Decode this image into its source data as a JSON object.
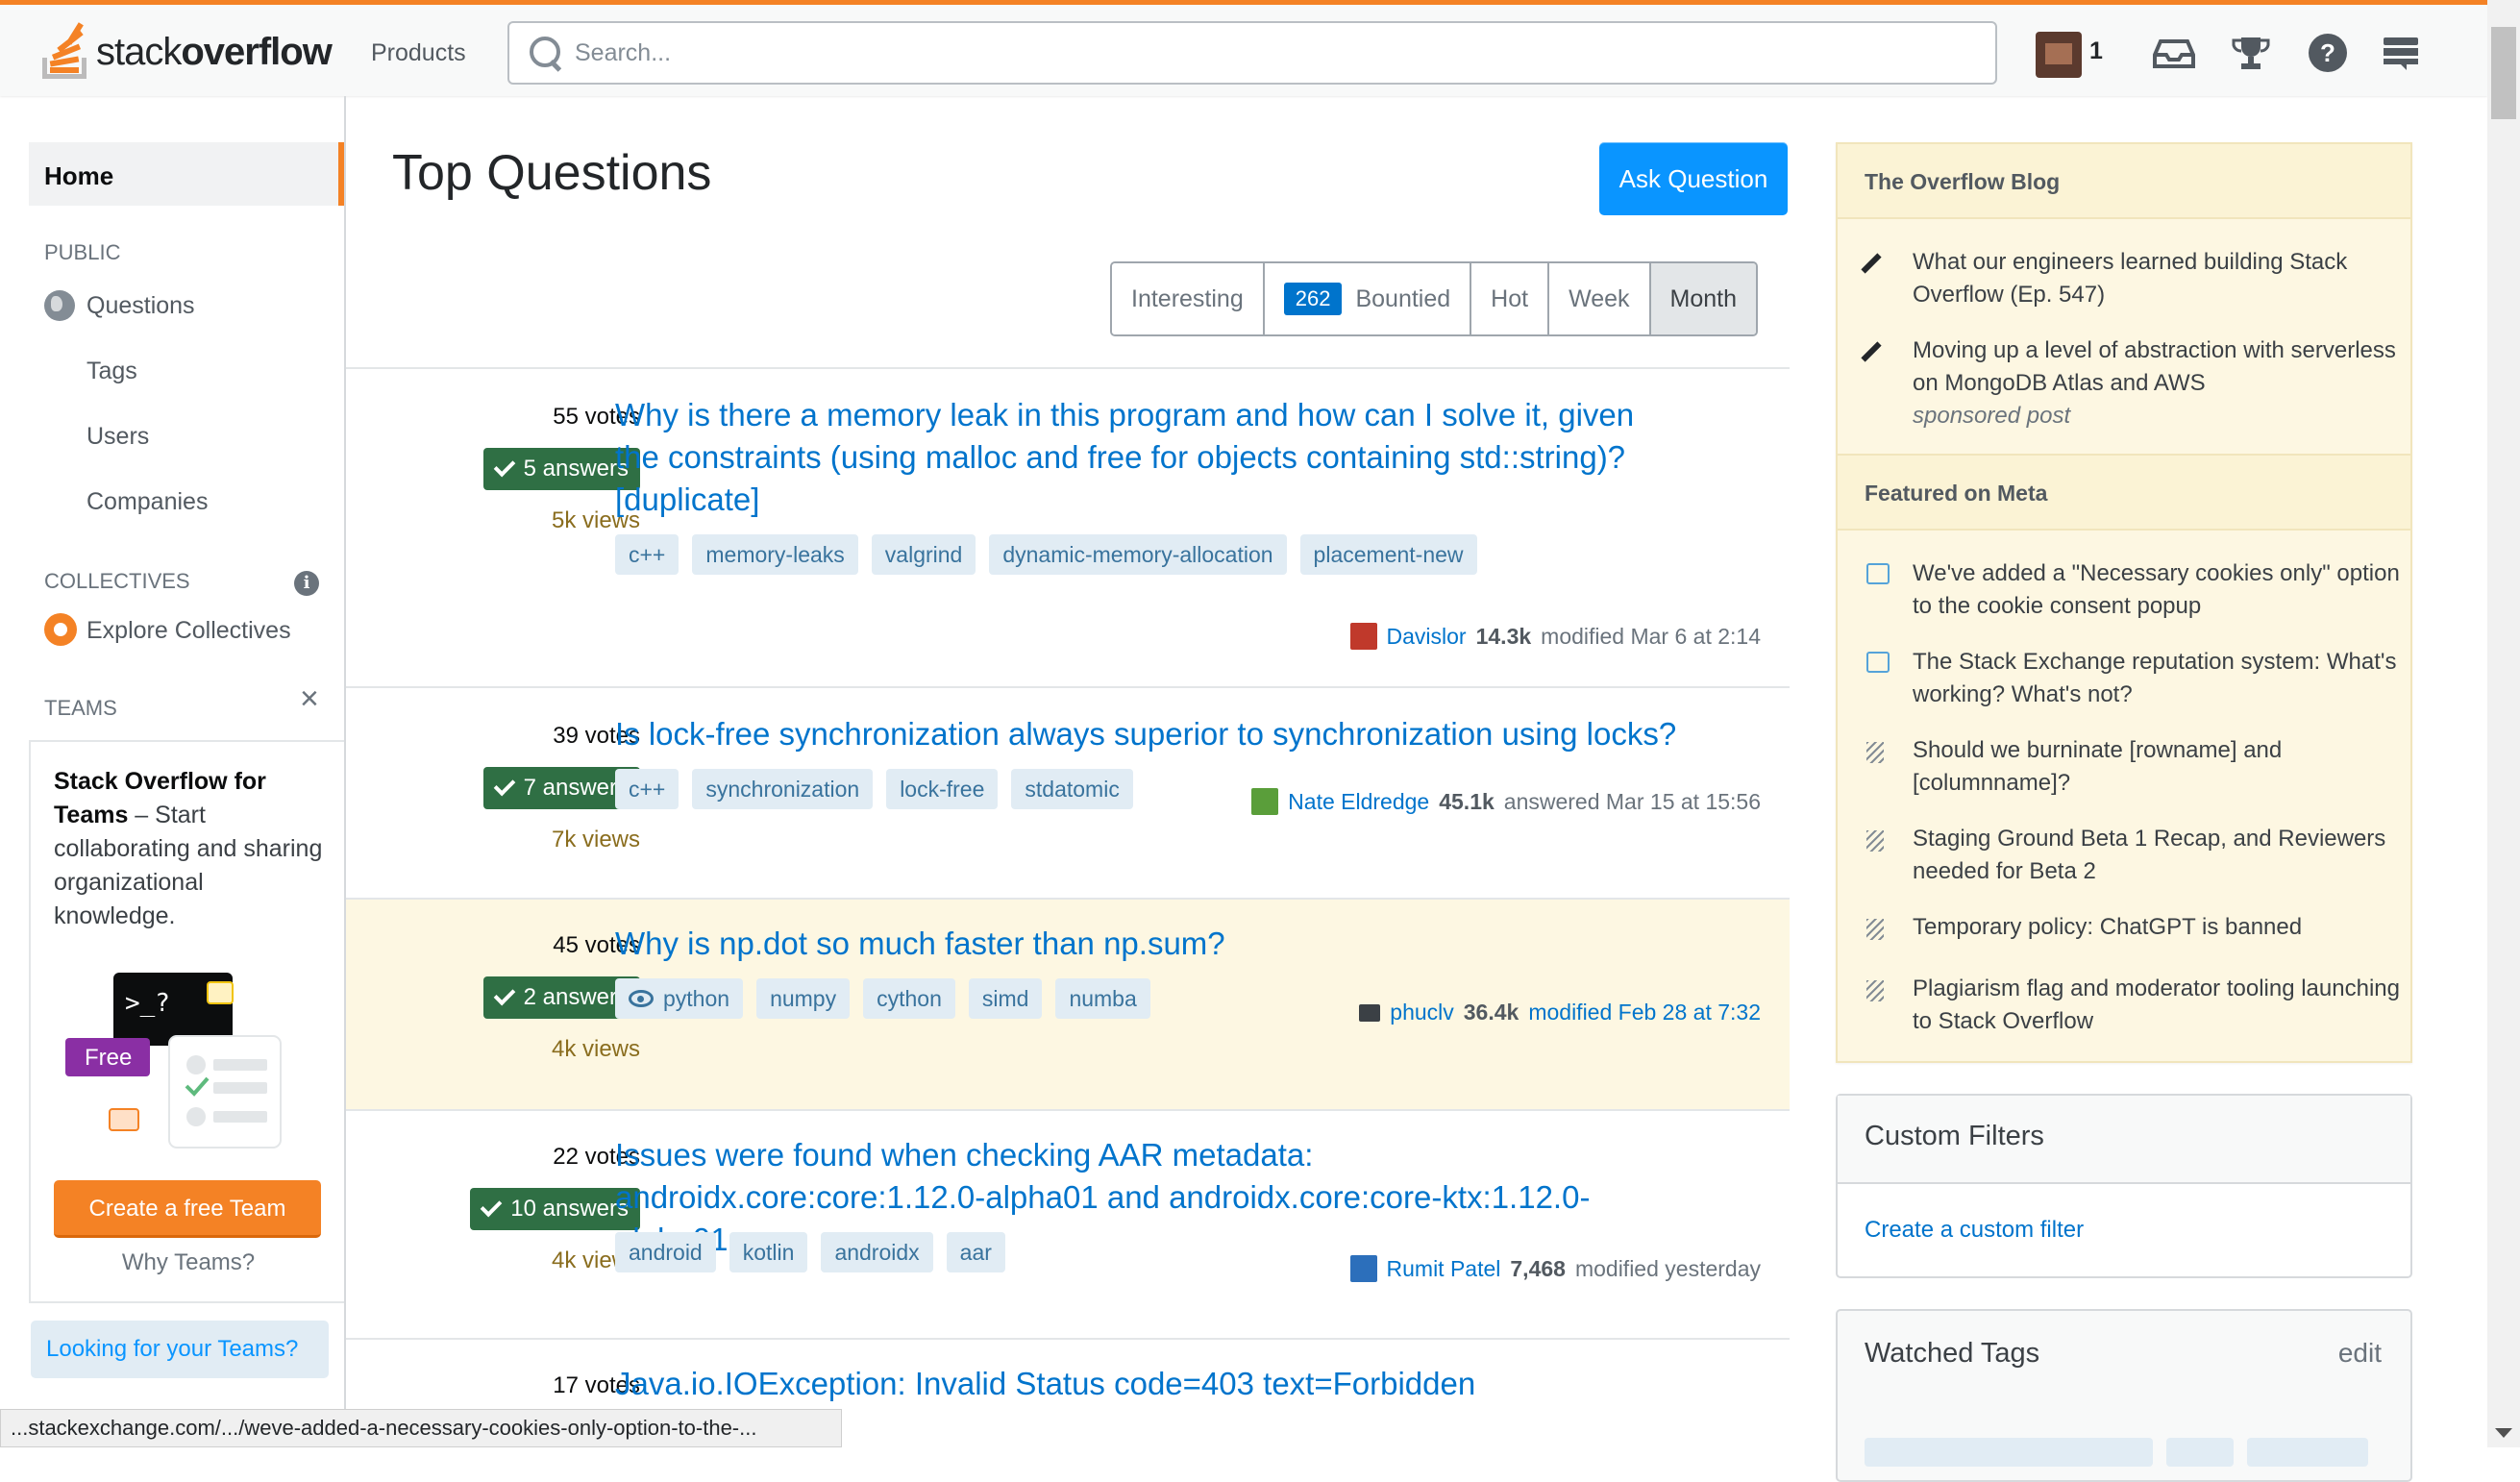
{
  "header": {
    "logo_text_light": "stack",
    "logo_text_bold": "overflow",
    "products_label": "Products",
    "search_placeholder": "Search...",
    "reputation": "1"
  },
  "leftnav": {
    "home": "Home",
    "public_label": "PUBLIC",
    "questions": "Questions",
    "tags": "Tags",
    "users": "Users",
    "companies": "Companies",
    "collectives_label": "COLLECTIVES",
    "explore_collectives": "Explore Collectives",
    "teams_label": "TEAMS",
    "teams_title_bold": "Stack Overflow for Teams",
    "teams_title_rest": " – Start collaborating and sharing organizational knowledge.",
    "teams_illus_free": "Free",
    "teams_illus_prompt": ">_?",
    "create_team": "Create a free Team",
    "why_teams": "Why Teams?",
    "looking_teams": "Looking for your Teams?"
  },
  "statusbar": "...stackexchange.com/.../weve-added-a-necessary-cookies-only-option-to-the-...",
  "main": {
    "title": "Top Questions",
    "ask_button": "Ask Question",
    "filters": [
      {
        "label": "Interesting"
      },
      {
        "label": "Bountied",
        "badge": "262"
      },
      {
        "label": "Hot"
      },
      {
        "label": "Week"
      },
      {
        "label": "Month",
        "active": true
      }
    ],
    "questions": [
      {
        "votes": "55 votes",
        "answers": "5 answers",
        "views": "5k views",
        "title": "Why is there a memory leak in this program and how can I solve it, given the constraints (using malloc and free for objects containing std::string)? [duplicate]",
        "tags": [
          "c++",
          "memory-leaks",
          "valgrind",
          "dynamic-memory-allocation",
          "placement-new"
        ],
        "user": "Davislor",
        "rep": "14.3k",
        "action": "modified Mar 6 at 2:14",
        "avatar_color": "#c0392b"
      },
      {
        "votes": "39 votes",
        "answers": "7 answers",
        "views": "7k views",
        "title": "Is lock-free synchronization always superior to synchronization using locks?",
        "tags": [
          "c++",
          "synchronization",
          "lock-free",
          "stdatomic"
        ],
        "user": "Nate Eldredge",
        "rep": "45.1k",
        "action": "answered Mar 15 at 15:56",
        "avatar_color": "#5a9e3a"
      },
      {
        "votes": "45 votes",
        "answers": "2 answers",
        "views": "4k views",
        "title": "Why is np.dot so much faster than np.sum?",
        "tags": [
          "python",
          "numpy",
          "cython",
          "simd",
          "numba"
        ],
        "watched_tag": "python",
        "user": "phuclv",
        "rep": "36.4k",
        "action": "modified Feb 28 at 7:32",
        "avatar_color": "#3b4045"
      },
      {
        "votes": "22 votes",
        "answers": "10 answers",
        "views": "4k views",
        "title": "Issues were found when checking AAR metadata: androidx.core:core:1.12.0-alpha01 and androidx.core:core-ktx:1.12.0-alpha01",
        "tags": [
          "android",
          "kotlin",
          "androidx",
          "aar"
        ],
        "user": "Rumit Patel",
        "rep": "7,468",
        "action": "modified yesterday",
        "avatar_color": "#2c6fbb"
      },
      {
        "votes": "17 votes",
        "title": "Java.io.IOException: Invalid Status code=403 text=Forbidden"
      }
    ]
  },
  "rightbar": {
    "blog_head": "The Overflow Blog",
    "blog_items": [
      {
        "text": "What our engineers learned building Stack Overflow (Ep. 547)"
      },
      {
        "text": "Moving up a level of abstraction with serverless on MongoDB Atlas and AWS",
        "note": "sponsored post"
      }
    ],
    "meta_head": "Featured on Meta",
    "meta_items": [
      {
        "icon": "chat-icon",
        "text": "We've added a \"Necessary cookies only\" option to the cookie consent popup"
      },
      {
        "icon": "chat-icon",
        "text": "The Stack Exchange reputation system: What's working? What's not?"
      },
      {
        "icon": "stack-icon",
        "text": "Should we burninate [rowname] and [columnname]?"
      },
      {
        "icon": "stack-icon",
        "text": "Staging Ground Beta 1 Recap, and Reviewers needed for Beta 2"
      },
      {
        "icon": "stack-icon",
        "text": "Temporary policy: ChatGPT is banned"
      },
      {
        "icon": "stack-icon",
        "text": "Plagiarism flag and moderator tooling launching to Stack Overflow"
      }
    ],
    "custom_filters_head": "Custom Filters",
    "custom_filters_link": "Create a custom filter",
    "watched_title": "Watched Tags",
    "watched_edit": "edit"
  },
  "colors": {
    "brand_orange": "#f48225",
    "link_blue": "#0074cc",
    "button_blue": "#0a95ff",
    "answered_green": "#2f6f44",
    "highlight_bg": "#fdf7e2"
  }
}
